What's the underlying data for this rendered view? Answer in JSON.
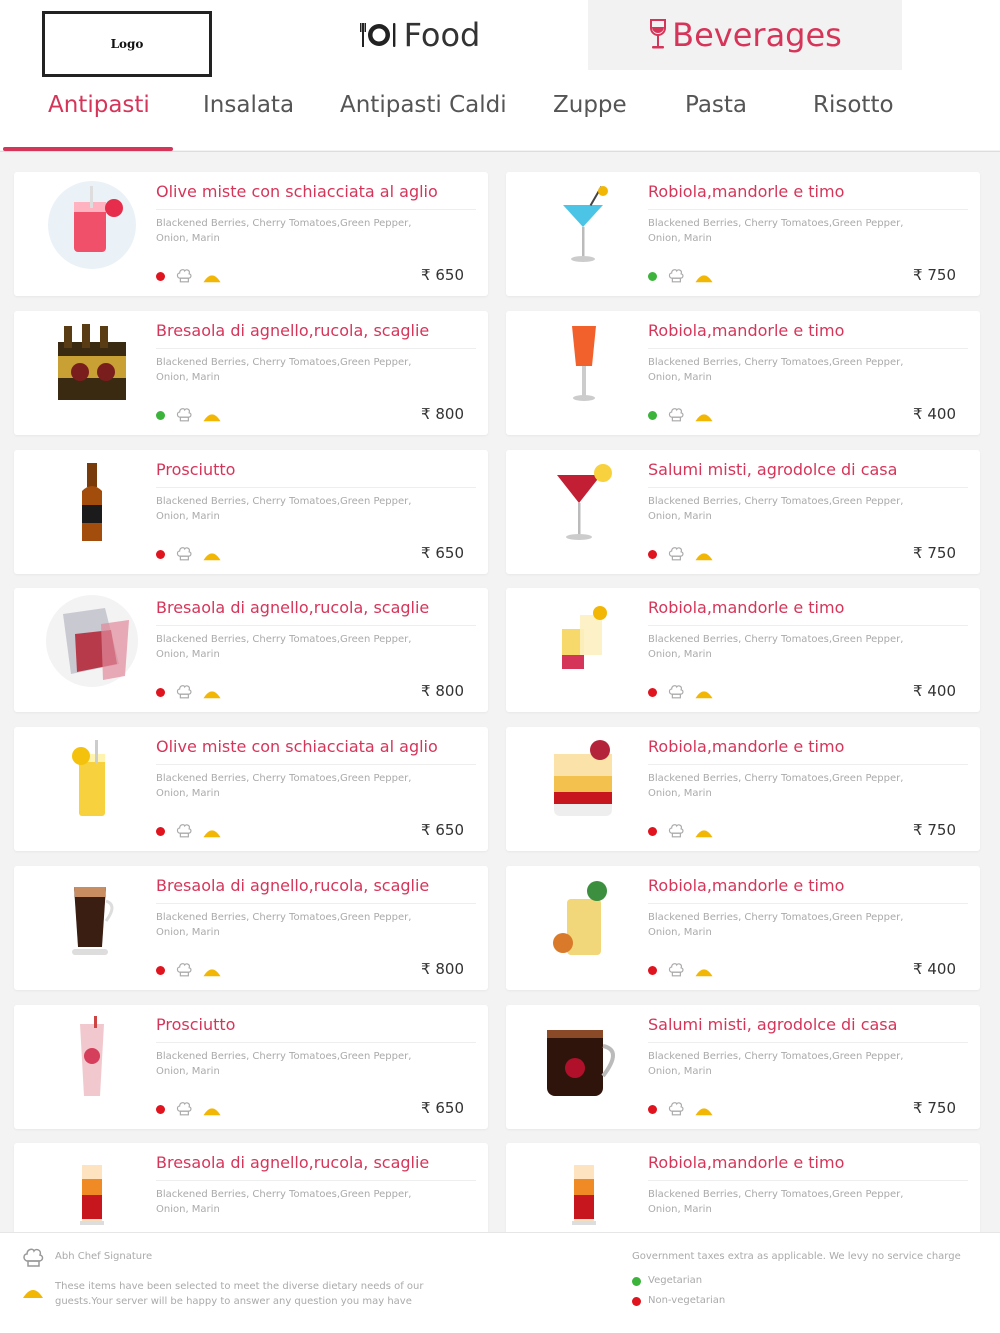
{
  "header": {
    "logo": "Logo",
    "sections": [
      {
        "label": "Food",
        "icon": "plate-cutlery-icon"
      },
      {
        "label": "Beverages",
        "icon": "wine-glass-icon"
      }
    ]
  },
  "categories": [
    "Antipasti",
    "Insalata",
    "Antipasti Caldi",
    "Zuppe",
    "Pasta",
    "Risotto"
  ],
  "colors": {
    "accent": "#d6355a",
    "veg": "#3cb43c",
    "nonveg": "#e0141e",
    "spice": "#f2b705"
  },
  "items_left": [
    {
      "title": "Olive miste con schiacciata al aglio",
      "desc": "Blackened Berries, Cherry Tomatoes,Green Pepper, Onion, Marin",
      "price": "₹ 650",
      "diet": "non-veg",
      "image": "pink-cocktail"
    },
    {
      "title": "Bresaola di agnello,rucola, scaglie",
      "desc": "Blackened Berries, Cherry Tomatoes,Green Pepper, Onion, Marin",
      "price": "₹ 800",
      "diet": "veg",
      "image": "beer-pack"
    },
    {
      "title": "Prosciutto",
      "desc": "Blackened Berries, Cherry Tomatoes,Green Pepper, Onion, Marin",
      "price": "₹ 650",
      "diet": "non-veg",
      "image": "beer-bottle"
    },
    {
      "title": "Bresaola di agnello,rucola, scaglie",
      "desc": "Blackened Berries, Cherry Tomatoes,Green Pepper, Onion, Marin",
      "price": "₹ 800",
      "diet": "non-veg",
      "image": "punch-pitcher"
    },
    {
      "title": "Olive miste con schiacciata al aglio",
      "desc": "Blackened Berries, Cherry Tomatoes,Green Pepper, Onion, Marin",
      "price": "₹ 650",
      "diet": "non-veg",
      "image": "lemonade"
    },
    {
      "title": "Bresaola di agnello,rucola, scaglie",
      "desc": "Blackened Berries, Cherry Tomatoes,Green Pepper, Onion, Marin",
      "price": "₹ 800",
      "diet": "non-veg",
      "image": "coffee-glass"
    },
    {
      "title": "Prosciutto",
      "desc": "Blackened Berries, Cherry Tomatoes,Green Pepper, Onion, Marin",
      "price": "₹ 650",
      "diet": "non-veg",
      "image": "milkshake"
    },
    {
      "title": "Bresaola di agnello,rucola, scaglie",
      "desc": "Blackened Berries, Cherry Tomatoes,Green Pepper, Onion, Marin",
      "price": "",
      "diet": "",
      "image": "sunrise-shot"
    }
  ],
  "items_right": [
    {
      "title": "Robiola,mandorle e timo",
      "desc": "Blackened Berries, Cherry Tomatoes,Green Pepper, Onion, Marin",
      "price": "₹ 750",
      "diet": "veg",
      "image": "blue-cocktail"
    },
    {
      "title": "Robiola,mandorle e timo",
      "desc": "Blackened Berries, Cherry Tomatoes,Green Pepper, Onion, Marin",
      "price": "₹ 400",
      "diet": "veg",
      "image": "orange-flute"
    },
    {
      "title": "Salumi misti, agrodolce di casa",
      "desc": "Blackened Berries, Cherry Tomatoes,Green Pepper, Onion, Marin",
      "price": "₹ 750",
      "diet": "non-veg",
      "image": "martini"
    },
    {
      "title": "Robiola,mandorle e timo",
      "desc": "Blackened Berries, Cherry Tomatoes,Green Pepper, Onion, Marin",
      "price": "₹ 400",
      "diet": "non-veg",
      "image": "layered-shots"
    },
    {
      "title": "Robiola,mandorle e timo",
      "desc": "Blackened Berries, Cherry Tomatoes,Green Pepper, Onion, Marin",
      "price": "₹ 750",
      "diet": "non-veg",
      "image": "iced-lowball"
    },
    {
      "title": "Robiola,mandorle e timo",
      "desc": "Blackened Berries, Cherry Tomatoes,Green Pepper, Onion, Marin",
      "price": "₹ 400",
      "diet": "non-veg",
      "image": "mojito"
    },
    {
      "title": "Salumi misti, agrodolce di casa",
      "desc": "Blackened Berries, Cherry Tomatoes,Green Pepper, Onion, Marin",
      "price": "₹ 750",
      "diet": "non-veg",
      "image": "coffee-mug"
    },
    {
      "title": "Robiola,mandorle e timo",
      "desc": "Blackened Berries, Cherry Tomatoes,Green Pepper, Onion, Marin",
      "price": "",
      "diet": "",
      "image": "sunrise-shot"
    }
  ],
  "footer": {
    "chef_signature": "Abh Chef Signature",
    "note": "These items have been selected to meet the diverse dietary needs of our guests.Your server will be happy to answer any question you may have",
    "tax_note": "Government taxes extra as applicable. We levy no service charge",
    "legend_veg": "Vegetarian",
    "legend_nonveg": "Non-vegetarian"
  }
}
